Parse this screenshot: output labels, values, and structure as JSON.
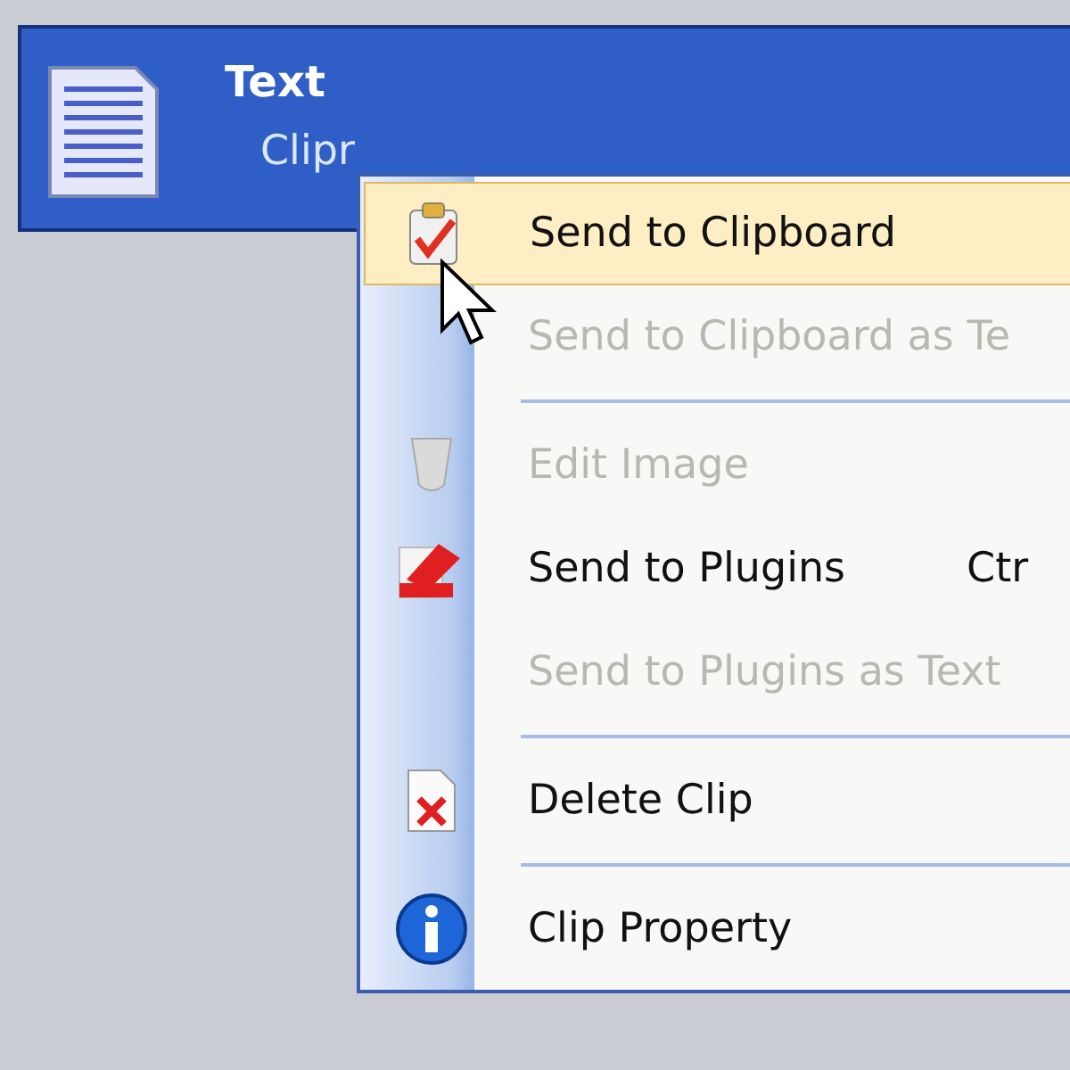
{
  "clip": {
    "title": "Text",
    "preview": "Clipr"
  },
  "menu": {
    "items": [
      {
        "kind": "item",
        "label": "Send to Clipboard",
        "disabled": false,
        "selected": true
      },
      {
        "kind": "item",
        "label": "Send to Clipboard as Te",
        "disabled": true,
        "selected": false
      },
      {
        "kind": "separator"
      },
      {
        "kind": "item",
        "label": "Edit Image",
        "disabled": true,
        "selected": false
      },
      {
        "kind": "item",
        "label": "Send to Plugins",
        "shortcut": "Ctr",
        "disabled": false,
        "selected": false
      },
      {
        "kind": "item",
        "label": "Send to Plugins as Text",
        "disabled": true,
        "selected": false
      },
      {
        "kind": "separator"
      },
      {
        "kind": "item",
        "label": "Delete Clip",
        "disabled": false,
        "selected": false
      },
      {
        "kind": "separator"
      },
      {
        "kind": "item",
        "label": "Clip Property",
        "disabled": false,
        "selected": false
      }
    ]
  }
}
